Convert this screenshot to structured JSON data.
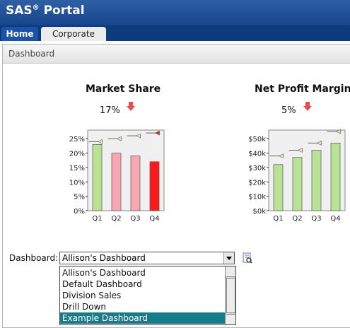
{
  "app": {
    "title": "SAS",
    "title_sup": "®",
    "title_rest": " Portal"
  },
  "tabs": [
    {
      "label": "Home",
      "active": true
    },
    {
      "label": "Corporate",
      "active": false
    }
  ],
  "panel": {
    "title": "Dashboard"
  },
  "colors": {
    "banner": "#1f4f98",
    "bar_green": "#b9e394",
    "bar_pink": "#f7a6b3",
    "bar_red": "#ff1a1a",
    "selected_item": "#147d8a",
    "trend_down_arrow": "#e05050"
  },
  "kpis": [
    {
      "title": "Market Share",
      "value": "17%",
      "trend": "down",
      "trend_icon": "arrow-down-icon"
    },
    {
      "title": "Net Profit Margin",
      "value": "5%",
      "trend": "down",
      "trend_icon": "arrow-down-icon"
    }
  ],
  "chart_data": [
    {
      "type": "bar",
      "title": "Market Share",
      "categories": [
        "Q1",
        "Q2",
        "Q3",
        "Q4"
      ],
      "values": [
        23,
        20,
        19,
        17
      ],
      "targets": [
        24,
        25,
        26,
        27
      ],
      "bar_colors": [
        "#b9e394",
        "#f7a6b3",
        "#f7a6b3",
        "#ff1a1a"
      ],
      "yticks": [
        "0%",
        "5%",
        "10%",
        "15%",
        "20%",
        "25%"
      ],
      "ylim": [
        0,
        28
      ],
      "grid": false
    },
    {
      "type": "bar",
      "title": "Net Profit Margin",
      "categories": [
        "Q1",
        "Q2",
        "Q3",
        "Q4"
      ],
      "values": [
        32,
        37,
        42,
        47
      ],
      "targets": [
        38,
        42,
        47,
        55
      ],
      "bar_colors": [
        "#b9e394",
        "#b9e394",
        "#b9e394",
        "#b9e394"
      ],
      "yticks": [
        "$0k",
        "$10k",
        "$20k",
        "$30k",
        "$40k",
        "$50k"
      ],
      "ylim": [
        0,
        56
      ],
      "grid": false
    }
  ],
  "dashboard_select": {
    "label": "Dashboard:",
    "value": "Allison's Dashboard",
    "options": [
      "Allison's Dashboard",
      "Default Dashboard",
      "Division Sales",
      "Drill Down",
      "Example Dashboard"
    ],
    "highlighted": "Example Dashboard",
    "edit_icon": "edit-dashboard-icon"
  }
}
